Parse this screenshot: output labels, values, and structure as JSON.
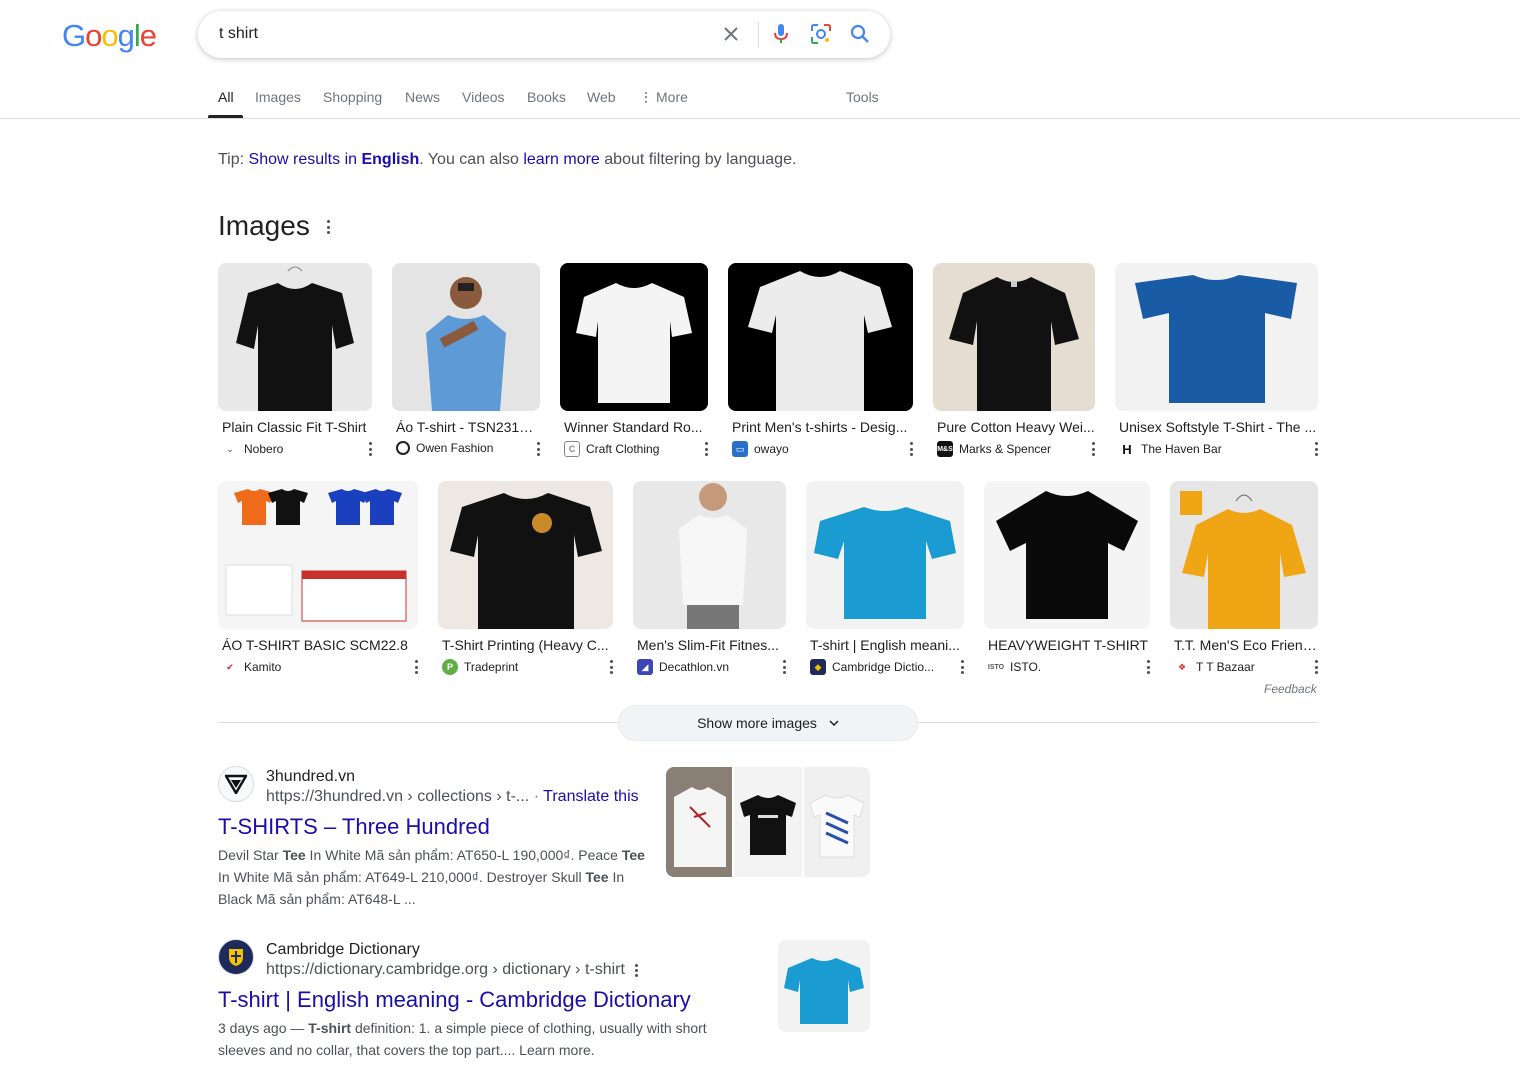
{
  "logo": {
    "text": "Google"
  },
  "search": {
    "query": "t shirt"
  },
  "tabs": {
    "all": "All",
    "images": "Images",
    "shopping": "Shopping",
    "news": "News",
    "videos": "Videos",
    "books": "Books",
    "web": "Web",
    "more": "More",
    "tools": "Tools"
  },
  "tip": {
    "prefix": "Tip: ",
    "show_results": "Show results in ",
    "language": "English",
    "middle": ". You can also ",
    "learn_more": "learn more",
    "suffix": " about filtering by language."
  },
  "images": {
    "heading": "Images",
    "row1": [
      {
        "title": "Plain Classic Fit T-Shirt",
        "source": "Nobero"
      },
      {
        "title": "Áo T-shirt - TSN231431",
        "source": "Owen Fashion"
      },
      {
        "title": "Winner Standard Ro...",
        "source": "Craft Clothing"
      },
      {
        "title": "Print Men's t-shirts - Desig...",
        "source": "owayo"
      },
      {
        "title": "Pure Cotton Heavy Wei...",
        "source": "Marks & Spencer"
      },
      {
        "title": "Unisex Softstyle T-Shirt - The ...",
        "source": "The Haven Bar"
      }
    ],
    "row2": [
      {
        "title": "ÁO T-SHIRT BASIC SCM22.8",
        "source": "Kamito"
      },
      {
        "title": "T-Shirt Printing (Heavy C...",
        "source": "Tradeprint"
      },
      {
        "title": "Men's Slim-Fit Fitnes...",
        "source": "Decathlon.vn"
      },
      {
        "title": "T-shirt | English meani...",
        "source": "Cambridge Dictio..."
      },
      {
        "title": "HEAVYWEIGHT T-SHIRT",
        "source": "ISTO."
      },
      {
        "title": "T.T. Men'S Eco Friend...",
        "source": "T T Bazaar"
      }
    ],
    "feedback": "Feedback",
    "show_more": "Show more images"
  },
  "results": [
    {
      "site": "3hundred.vn",
      "url": "https://3hundred.vn › collections › t-...",
      "translate": "Translate this",
      "title": "T-SHIRTS – Three Hundred",
      "snippet_lines": [
        "Devil Star Tee In White Mã sản phẩm: AT650-L 190,000₫. Peace Tee",
        "In White Mã sản phẩm: AT649-L 210,000₫. Destroyer Skull Tee In",
        "Black Mã sản phẩm: AT648-L ..."
      ]
    },
    {
      "site": "Cambridge Dictionary",
      "url": "https://dictionary.cambridge.org › dictionary › t-shirt",
      "title": "T-shirt | English meaning - Cambridge Dictionary",
      "snippet_lines": [
        "3 days ago — T-shirt definition: 1. a simple piece of clothing, usually with short",
        "sleeves and no collar, that covers the top part.... Learn more."
      ]
    }
  ],
  "colors": {
    "link": "#1a0dab",
    "text": "#202124",
    "muted": "#4d5156",
    "google_blue": "#4285F4",
    "google_red": "#EA4335",
    "google_yellow": "#FBBC05",
    "google_green": "#34A853"
  }
}
